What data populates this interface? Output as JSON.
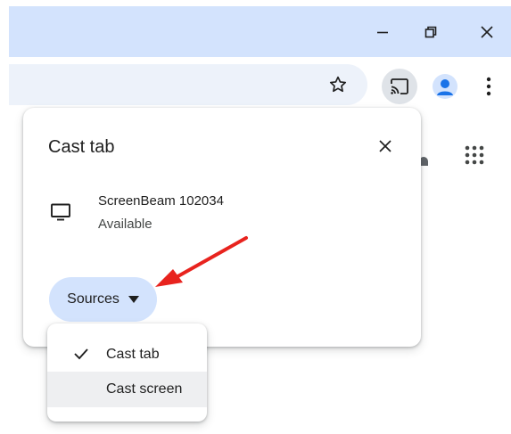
{
  "window_controls": {
    "minimize_icon": "minimize-icon",
    "restore_icon": "restore-icon",
    "close_icon": "close-icon"
  },
  "toolbar": {
    "bookmark_icon": "star-icon",
    "cast_icon": "cast-icon",
    "profile_icon": "profile-icon",
    "menu_icon": "more-vert-icon"
  },
  "cast_dialog": {
    "title": "Cast tab",
    "close_icon": "close-icon",
    "sinks": [
      {
        "name": "ScreenBeam 102034",
        "status": "Available",
        "icon": "monitor-icon"
      }
    ],
    "sources_button": {
      "label": "Sources",
      "icon": "caret-down-icon"
    }
  },
  "sources_menu": {
    "items": [
      {
        "label": "Cast tab",
        "checked": true
      },
      {
        "label": "Cast screen",
        "checked": false,
        "highlighted": true
      }
    ]
  },
  "colors": {
    "titlebar": "#d3e3fd",
    "omnibox": "#edf2fa",
    "sources_button": "#d3e3fd",
    "annotation_arrow": "#e8231e",
    "profile": "#1a73e8"
  }
}
